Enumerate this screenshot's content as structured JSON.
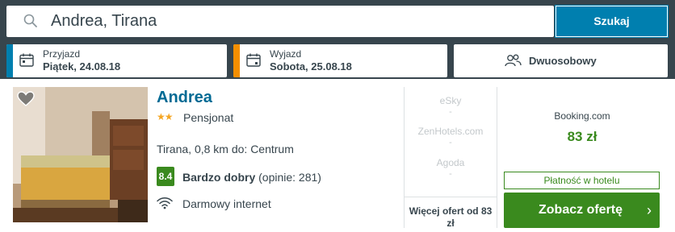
{
  "search": {
    "query": "Andrea, Tirana",
    "button_label": "Szukaj"
  },
  "checkin": {
    "label": "Przyjazd",
    "value": "Piątek, 24.08.18"
  },
  "checkout": {
    "label": "Wyjazd",
    "value": "Sobota, 25.08.18"
  },
  "room": {
    "label": "Dwuosobowy"
  },
  "hotel": {
    "name": "Andrea",
    "stars": "★★",
    "type": "Pensjonat",
    "location": "Tirana, 0,8 km do: Centrum",
    "rating_score": "8.4",
    "rating_label": "Bardzo dobry",
    "rating_count": "(opinie: 281)",
    "amenity": "Darmowy internet"
  },
  "other_offers": [
    {
      "name": "eSky",
      "price": "-"
    },
    {
      "name": "ZenHotels.com",
      "price": "-"
    },
    {
      "name": "Agoda",
      "price": "-"
    }
  ],
  "more_offers_label": "Więcej ofert od 83 zł",
  "deal": {
    "provider": "Booking.com",
    "price": "83 zł",
    "payment_note": "Płatność w hotelu",
    "button_label": "Zobacz ofertę",
    "button_chevron": "›"
  },
  "colors": {
    "header": "#37454d",
    "accent_blue": "#007faf",
    "accent_orange": "#f48f00",
    "green": "#3a8a1e",
    "name_blue": "#006a94"
  }
}
